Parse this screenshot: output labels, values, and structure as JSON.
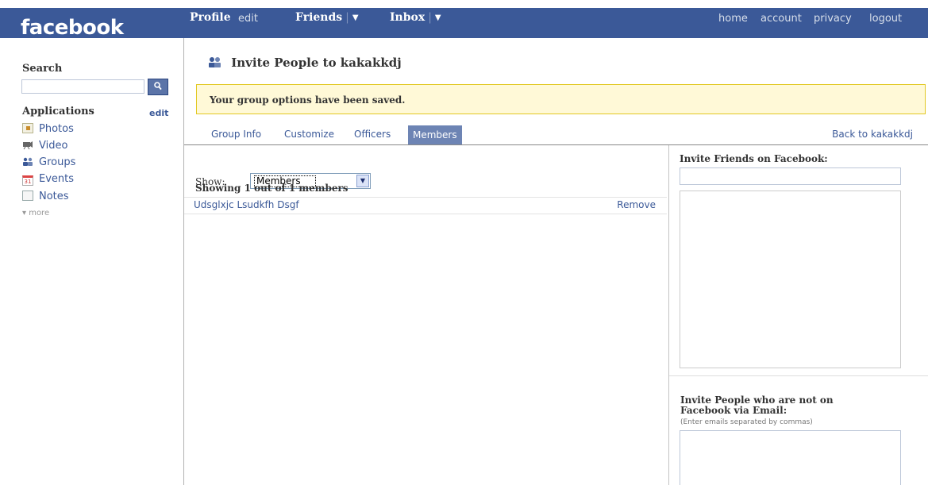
{
  "brand": {
    "logo": "facebook"
  },
  "topnav": {
    "profile": "Profile",
    "edit": "edit",
    "friends": "Friends",
    "inbox": "Inbox",
    "dropdown_icon": "triangle-down-icon",
    "right_links": [
      "home",
      "account",
      "privacy",
      "logout"
    ]
  },
  "sidebar": {
    "search_label": "Search",
    "search_value": "",
    "search_icon": "magnifier-icon",
    "applications_label": "Applications",
    "applications_edit": "edit",
    "apps": [
      {
        "label": "Photos",
        "icon": "photos-icon"
      },
      {
        "label": "Video",
        "icon": "video-icon"
      },
      {
        "label": "Groups",
        "icon": "groups-icon"
      },
      {
        "label": "Events",
        "icon": "events-icon"
      },
      {
        "label": "Notes",
        "icon": "notes-icon"
      }
    ],
    "more": "▾ more",
    "events_icon_text": "31"
  },
  "main": {
    "title": "Invite People to kakakkdj",
    "notice": "Your group options have been saved.",
    "tabs": [
      "Group Info",
      "Customize",
      "Officers",
      "Members"
    ],
    "active_tab": "Members",
    "back_link": "Back to kakakkdj",
    "show_label": "Show:",
    "show_value": "Members",
    "count_text": "Showing 1 out of 1 members",
    "members": [
      {
        "name": "Udsglxjc Lsudkfh Dsgf",
        "action": "Remove"
      }
    ]
  },
  "right": {
    "invite_friends_title": "Invite Friends on Facebook:",
    "invite_friends_value": "",
    "invite_email_title": "Invite People who are not on Facebook via Email:",
    "invite_email_hint": "(Enter emails separated by commas)",
    "invite_email_value": ""
  },
  "colors": {
    "brand_blue": "#3b5998",
    "active_tab": "#6d84b4",
    "notice_bg": "#fff9d7",
    "notice_border": "#e2c822"
  }
}
